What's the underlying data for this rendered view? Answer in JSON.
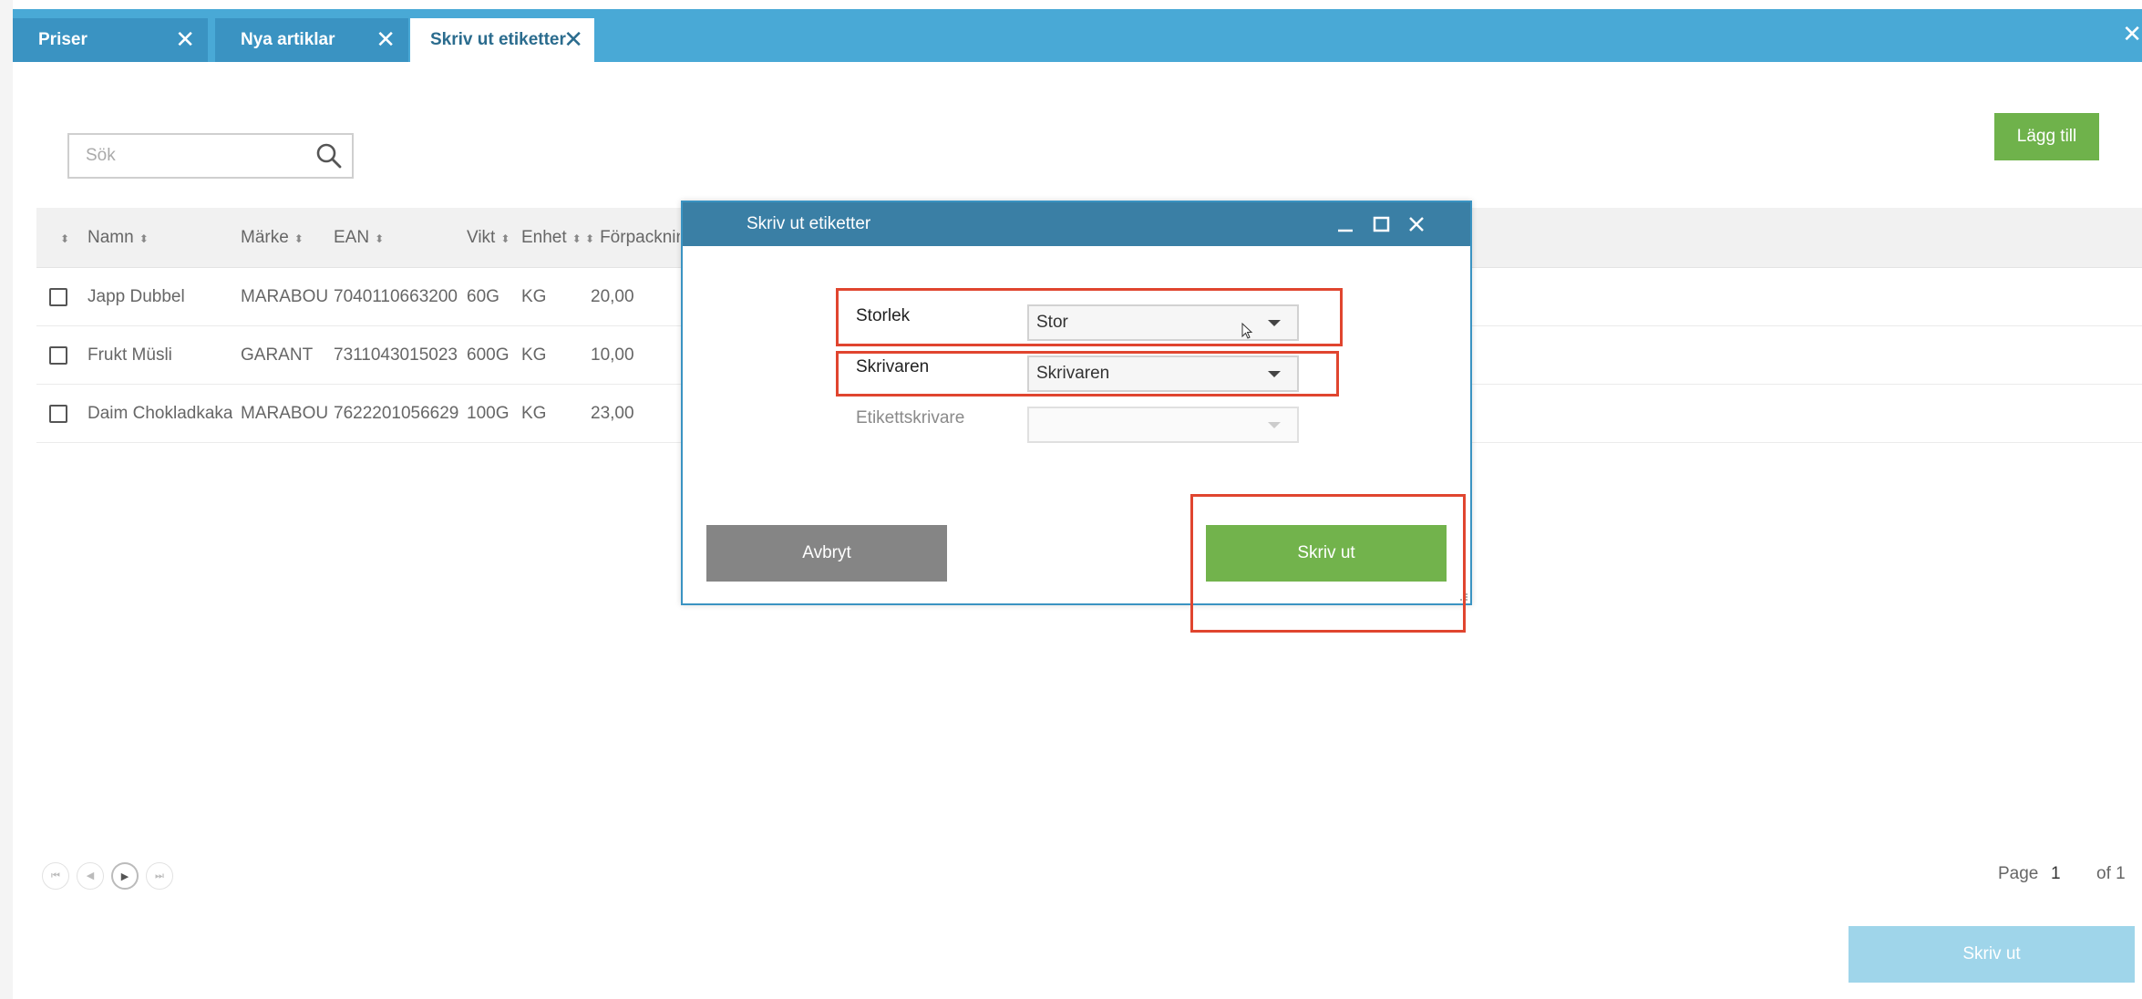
{
  "tabs": [
    {
      "label": "Priser",
      "close": "✕"
    },
    {
      "label": "Nya artiklar",
      "close": "✕"
    },
    {
      "label": "Skriv ut etiketter",
      "close": "✕"
    }
  ],
  "tabbar_close": "✕",
  "search": {
    "placeholder": "Sök"
  },
  "add_button": "Lägg till",
  "table": {
    "headers": [
      "Namn",
      "Märke",
      "EAN",
      "Vikt",
      "Enhet",
      "Förpackning"
    ],
    "rows": [
      {
        "namn": "Japp Dubbel",
        "marke": "MARABOU",
        "ean": "7040110663200",
        "vikt": "60G",
        "enhet": "KG",
        "forpackning": "20,00"
      },
      {
        "namn": "Frukt Müsli",
        "marke": "GARANT",
        "ean": "7311043015023",
        "vikt": "600G",
        "enhet": "KG",
        "forpackning": "10,00"
      },
      {
        "namn": "Daim Chokladkaka",
        "marke": "MARABOU",
        "ean": "7622201056629",
        "vikt": "100G",
        "enhet": "KG",
        "forpackning": "23,00"
      }
    ]
  },
  "pager": {
    "page_label": "Page",
    "page": "1",
    "of_label": "of 1"
  },
  "print_button": "Skriv ut",
  "dialog": {
    "title": "Skriv ut etiketter",
    "storlek_label": "Storlek",
    "storlek_value": "Stor",
    "skrivaren_label": "Skrivaren",
    "skrivaren_value": "Skrivaren",
    "etikettskrivare_label": "Etikettskrivare",
    "etikettskrivare_value": "",
    "cancel": "Avbryt",
    "print": "Skriv ut"
  },
  "colors": {
    "tabbar": "#49a9d6",
    "dialog_title": "#3a7fa5",
    "green": "#72b34c",
    "highlight": "#e0452f"
  }
}
